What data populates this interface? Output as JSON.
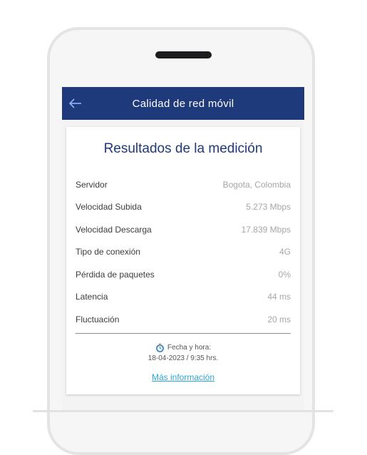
{
  "header": {
    "title": "Calidad de red móvil",
    "back_icon": "arrow-left-icon"
  },
  "card": {
    "title": "Resultados de la medición",
    "rows": [
      {
        "label": "Servidor",
        "value": "Bogota, Colombia"
      },
      {
        "label": "Velocidad Subida",
        "value": "5.273 Mbps"
      },
      {
        "label": "Velocidad Descarga",
        "value": "17.839 Mbps"
      },
      {
        "label": "Tipo de conexión",
        "value": "4G"
      },
      {
        "label": "Pérdida de paquetes",
        "value": "0%"
      },
      {
        "label": "Latencia",
        "value": "44 ms"
      },
      {
        "label": "Fluctuación",
        "value": "20 ms"
      }
    ],
    "footer": {
      "date_label": "Fecha y hora:",
      "date_value": "18-04-2023 / 9:35 hrs.",
      "more_link": "Más información",
      "date_icon": "stopwatch-icon"
    }
  },
  "colors": {
    "header_bg": "#1f3a7a",
    "accent_link": "#2aa7d6",
    "title": "#1f3a7a"
  }
}
